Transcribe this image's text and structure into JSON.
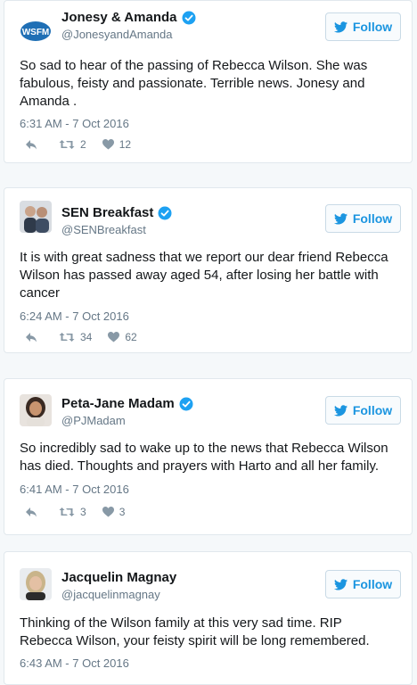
{
  "colors": {
    "accent": "#1b95e0",
    "verified": "#1da1f2",
    "muted": "#657786"
  },
  "tweets": [
    {
      "name": "Jonesy & Amanda",
      "handle": "@JonesyandAmanda",
      "follow_label": "Follow",
      "text": "So sad to hear of the passing of Rebecca Wilson. She was fabulous, feisty and passionate. Terrible news. Jonesy and Amanda .",
      "time": "6:31 AM - 7 Oct 2016",
      "retweets": "2",
      "likes": "12",
      "avatar_icon": "wsfm-logo-icon"
    },
    {
      "name": "SEN Breakfast",
      "handle": "@SENBreakfast",
      "follow_label": "Follow",
      "text": "It is with great sadness that we report our dear friend Rebecca Wilson has passed away aged 54, after losing her battle with cancer",
      "time": "6:24 AM - 7 Oct 2016",
      "retweets": "34",
      "likes": "62",
      "avatar_icon": "hosts-photo-icon"
    },
    {
      "name": "Peta-Jane Madam",
      "handle": "@PJMadam",
      "follow_label": "Follow",
      "text": "So incredibly sad to wake up to the news that Rebecca Wilson has died. Thoughts and prayers with Harto and all her family.",
      "time": "6:41 AM - 7 Oct 2016",
      "retweets": "3",
      "likes": "3",
      "avatar_icon": "portrait-photo-icon"
    },
    {
      "name": "Jacquelin Magnay",
      "handle": "@jacquelinmagnay",
      "follow_label": "Follow",
      "text": "Thinking of the Wilson family at this very sad time. RIP Rebecca Wilson, your feisty spirit will be long remembered.",
      "time": "6:43 AM - 7 Oct 2016",
      "avatar_icon": "portrait-photo-icon"
    }
  ]
}
